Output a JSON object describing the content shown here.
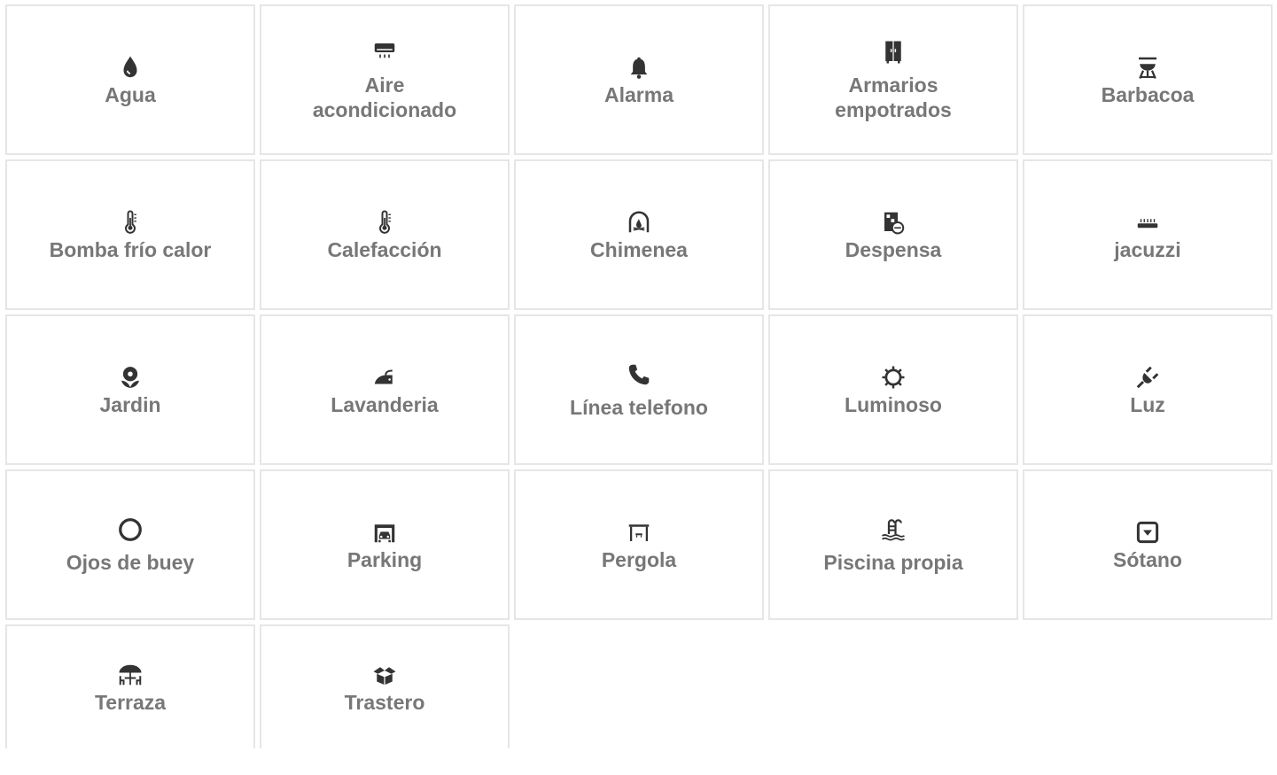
{
  "amenities": {
    "colors": {
      "icon": "#333333",
      "label": "#777777",
      "border": "#e6e6e6"
    },
    "items": [
      {
        "label": "Agua",
        "icon": "water-drop-icon"
      },
      {
        "label": "Aire acondicionado",
        "icon": "air-conditioner-icon"
      },
      {
        "label": "Alarma",
        "icon": "bell-icon"
      },
      {
        "label": "Armarios empotrados",
        "icon": "wardrobe-icon"
      },
      {
        "label": "Barbacoa",
        "icon": "barbecue-grill-icon"
      },
      {
        "label": "Bomba frío calor",
        "icon": "thermometer-icon"
      },
      {
        "label": "Calefacción",
        "icon": "thermometer-icon"
      },
      {
        "label": "Chimenea",
        "icon": "fireplace-icon"
      },
      {
        "label": "Despensa",
        "icon": "pantry-icon"
      },
      {
        "label": "jacuzzi",
        "icon": "hot-tub-icon"
      },
      {
        "label": "Jardin",
        "icon": "flower-icon"
      },
      {
        "label": "Lavanderia",
        "icon": "iron-icon"
      },
      {
        "label": "Línea telefono",
        "icon": "phone-icon"
      },
      {
        "label": "Luminoso",
        "icon": "sun-icon"
      },
      {
        "label": "Luz",
        "icon": "plug-icon"
      },
      {
        "label": "Ojos de buey",
        "icon": "circle-icon"
      },
      {
        "label": "Parking",
        "icon": "garage-car-icon"
      },
      {
        "label": "Pergola",
        "icon": "pergola-icon"
      },
      {
        "label": "Piscina propia",
        "icon": "pool-ladder-icon"
      },
      {
        "label": "Sótano",
        "icon": "basement-icon"
      },
      {
        "label": "Terraza",
        "icon": "terrace-umbrella-icon"
      },
      {
        "label": "Trastero",
        "icon": "storage-box-icon"
      }
    ]
  }
}
